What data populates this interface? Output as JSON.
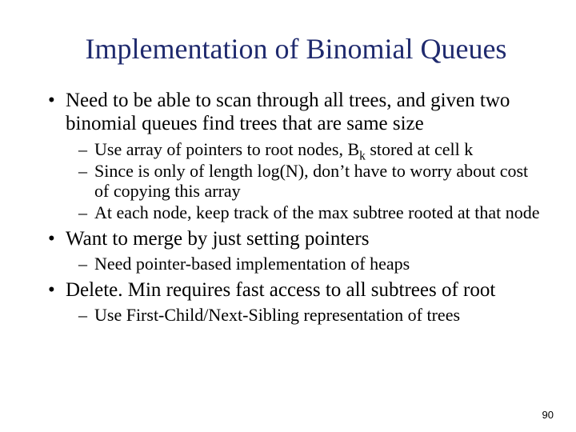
{
  "title": "Implementation of Binomial Queues",
  "bullets": [
    {
      "text": "Need to be able to scan through all trees, and given two binomial queues find trees that are same size",
      "sub": [
        {
          "prefix": "Use array of pointers to root nodes, B",
          "subscript": "k",
          "suffix": " stored at cell k"
        },
        {
          "prefix": "Since is only of length log(N), don’t have to worry about cost of copying this array"
        },
        {
          "prefix": "At each node, keep track of the max  subtree rooted at that node"
        }
      ]
    },
    {
      "text": "Want to merge by just setting pointers",
      "sub": [
        {
          "prefix": "Need pointer-based implementation of heaps"
        }
      ]
    },
    {
      "text": "Delete. Min requires fast access to all subtrees of root",
      "sub": [
        {
          "prefix": "Use First-Child/Next-Sibling representation of trees"
        }
      ]
    }
  ],
  "page": "90"
}
